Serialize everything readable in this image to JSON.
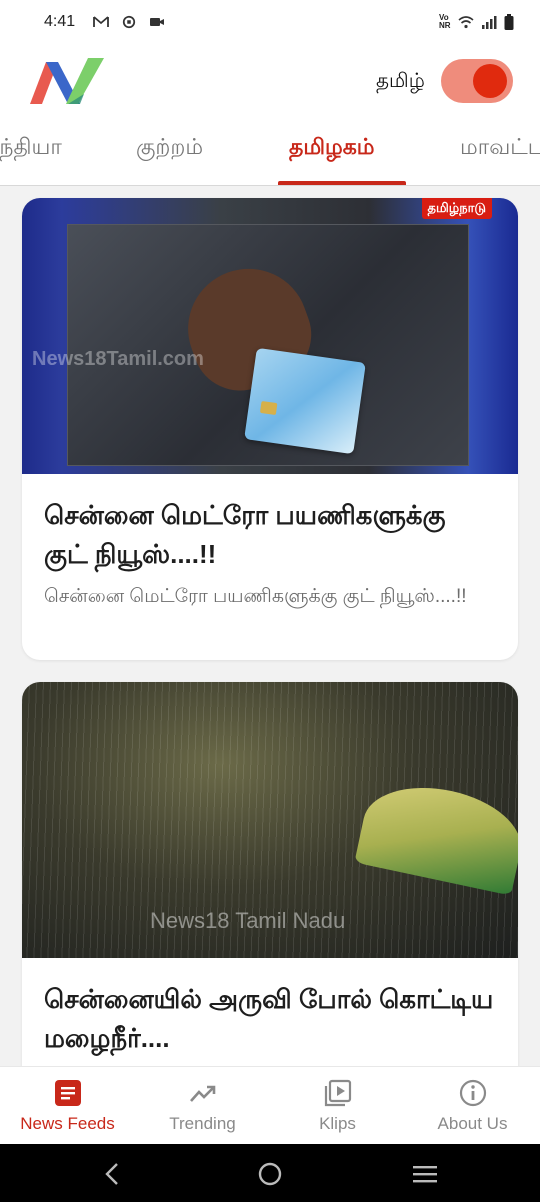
{
  "status_bar": {
    "time": "4:41",
    "left_icons": [
      "gmail-icon",
      "sync-icon",
      "video-icon"
    ],
    "right_icons": [
      "volte-icon",
      "wifi-icon",
      "signal-icon",
      "battery-icon"
    ],
    "volte_text": "Vo NR"
  },
  "header": {
    "logo": "news18-logo",
    "language_label": "தமிழ்",
    "toggle_on": true,
    "toggle_color": "#e02a0e"
  },
  "tabs": [
    {
      "label": "இந்தியா",
      "active": false
    },
    {
      "label": "குற்றம்",
      "active": false
    },
    {
      "label": "தமிழகம்",
      "active": true
    },
    {
      "label": "மாவட்டம்",
      "active": false
    }
  ],
  "feed": {
    "cards": [
      {
        "badge": "தமிழ்நாடு",
        "watermark": "News18Tamil.com",
        "title": "சென்னை மெட்ரோ பயணிகளுக்கு குட் நியூஸ்....!!",
        "description": "சென்னை மெட்ரோ பயணிகளுக்கு குட் நியூஸ்....!!"
      },
      {
        "watermark": "News18 Tamil Nadu",
        "title": "சென்னையில் அருவி போல் கொட்டிய மழைநீர்....",
        "description": ""
      }
    ]
  },
  "bottom_nav": [
    {
      "label": "News Feeds",
      "icon": "news-feed-icon",
      "active": true
    },
    {
      "label": "Trending",
      "icon": "trending-icon",
      "active": false
    },
    {
      "label": "Klips",
      "icon": "video-clips-icon",
      "active": false
    },
    {
      "label": "About Us",
      "icon": "info-icon",
      "active": false
    }
  ],
  "colors": {
    "accent": "#c8281a",
    "toggle_track": "#ef8c7c",
    "nav_inactive": "#8a8a8a"
  }
}
